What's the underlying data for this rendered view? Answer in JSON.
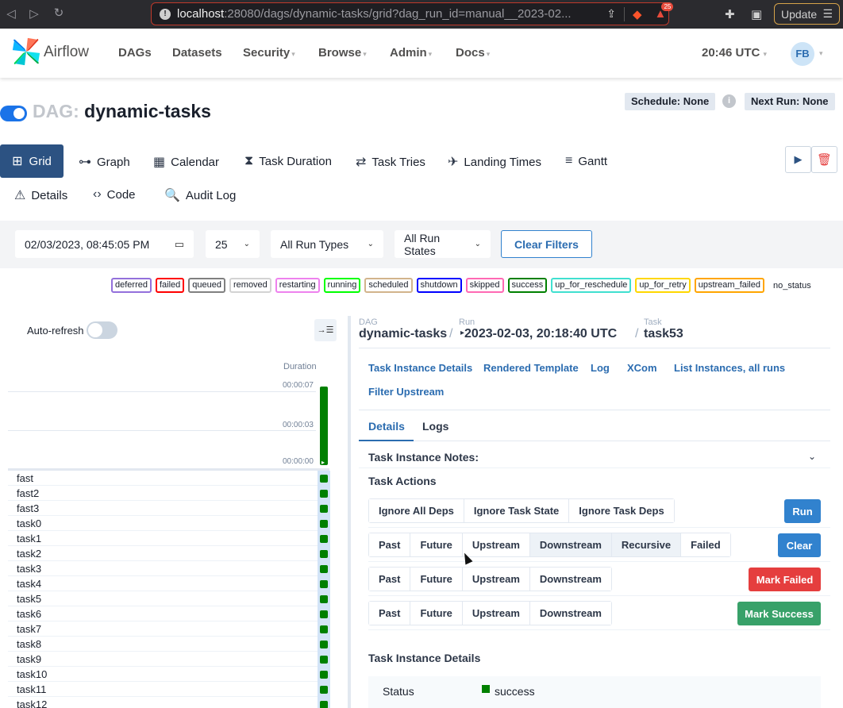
{
  "browser": {
    "url_host": "localhost",
    "url_path": ":28080/dags/dynamic-tasks/grid?dag_run_id=manual__2023-02...",
    "shields_count": "25",
    "update_label": "Update"
  },
  "nav": {
    "brand": "Airflow",
    "items": [
      "DAGs",
      "Datasets",
      "Security",
      "Browse",
      "Admin",
      "Docs"
    ],
    "time": "20:46 UTC",
    "user_initials": "FB"
  },
  "dag": {
    "prefix": "DAG:",
    "name": "dynamic-tasks",
    "schedule": "Schedule: None",
    "next_run": "Next Run: None"
  },
  "views": {
    "grid": "Grid",
    "graph": "Graph",
    "calendar": "Calendar",
    "task_duration": "Task Duration",
    "task_tries": "Task Tries",
    "landing_times": "Landing Times",
    "gantt": "Gantt",
    "details": "Details",
    "code": "Code",
    "audit_log": "Audit Log"
  },
  "filters": {
    "date": "02/03/2023, 08:45:05 PM",
    "num_runs": "25",
    "run_types": "All Run Types",
    "run_states": "All Run States",
    "clear": "Clear Filters"
  },
  "legend": [
    {
      "label": "deferred",
      "color": "#9370db"
    },
    {
      "label": "failed",
      "color": "#ff0000"
    },
    {
      "label": "queued",
      "color": "#808080"
    },
    {
      "label": "removed",
      "color": "#d3d3d3"
    },
    {
      "label": "restarting",
      "color": "#ee82ee"
    },
    {
      "label": "running",
      "color": "#00ff00"
    },
    {
      "label": "scheduled",
      "color": "#d2b48c"
    },
    {
      "label": "shutdown",
      "color": "#0000ff"
    },
    {
      "label": "skipped",
      "color": "#ff69b4"
    },
    {
      "label": "success",
      "color": "#008000"
    },
    {
      "label": "up_for_reschedule",
      "color": "#40e0d0"
    },
    {
      "label": "up_for_retry",
      "color": "#ffd700"
    },
    {
      "label": "upstream_failed",
      "color": "#ffa500"
    }
  ],
  "legend_no_status": "no_status",
  "grid": {
    "auto_refresh": "Auto-refresh",
    "duration_label": "Duration",
    "ticks": [
      "00:00:07",
      "00:00:03",
      "00:00:00"
    ],
    "tasks": [
      "fast",
      "fast2",
      "fast3",
      "task0",
      "task1",
      "task2",
      "task3",
      "task4",
      "task5",
      "task6",
      "task7",
      "task8",
      "task9",
      "task10",
      "task11",
      "task12"
    ],
    "success_color": "#008000"
  },
  "details": {
    "bc_dag_label": "DAG",
    "bc_dag": "dynamic-tasks",
    "bc_run_label": "Run",
    "bc_run": "2023-02-03, 20:18:40 UTC",
    "bc_task_label": "Task",
    "bc_task": "task53",
    "links": [
      "Task Instance Details",
      "Rendered Template",
      "Log",
      "XCom",
      "List Instances, all runs",
      "Filter Upstream"
    ],
    "tab_details": "Details",
    "tab_logs": "Logs",
    "notes_title": "Task Instance Notes:",
    "actions_title": "Task Actions",
    "run_group": [
      "Ignore All Deps",
      "Ignore Task State",
      "Ignore Task Deps"
    ],
    "run_btn": "Run",
    "clear_group": [
      "Past",
      "Future",
      "Upstream",
      "Downstream",
      "Recursive",
      "Failed"
    ],
    "clear_btn": "Clear",
    "failed_group": [
      "Past",
      "Future",
      "Upstream",
      "Downstream"
    ],
    "failed_btn": "Mark Failed",
    "success_group": [
      "Past",
      "Future",
      "Upstream",
      "Downstream"
    ],
    "success_btn": "Mark Success",
    "ti_details_title": "Task Instance Details",
    "status_key": "Status",
    "status_val": "success"
  }
}
